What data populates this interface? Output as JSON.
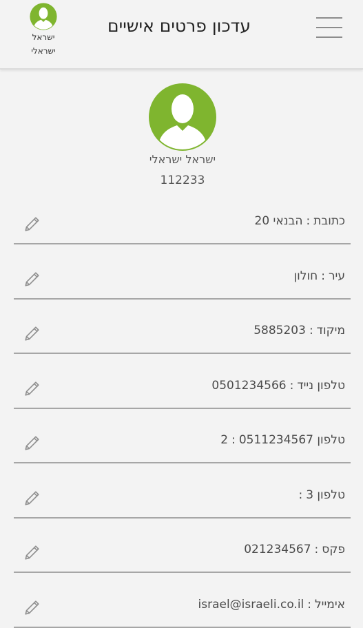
{
  "header": {
    "title": "עדכון פרטים אישיים",
    "user_first": "ישראל",
    "user_last": "ישראלי",
    "avatar_icon": "user-avatar-icon",
    "menu_icon": "hamburger-menu-icon"
  },
  "profile": {
    "name": "ישראל ישראלי",
    "id": "112233",
    "avatar_icon": "user-avatar-icon"
  },
  "colors": {
    "avatar_green": "#7fb52f",
    "line": "#a6a6a6",
    "background": "#f3f3f3"
  },
  "fields": [
    {
      "label": "כתובת",
      "value": "הבנאי 20"
    },
    {
      "label": "עיר",
      "value": "חולון"
    },
    {
      "label": "מיקוד",
      "value": "5885203"
    },
    {
      "label": "טלפון נייד",
      "value": "0501234566"
    },
    {
      "label": "טלפון 2",
      "value": "0511234567"
    },
    {
      "label": "טלפון 3",
      "value": ""
    },
    {
      "label": "פקס",
      "value": "021234567"
    },
    {
      "label": "אימייל",
      "value": "israel@israeli.co.il"
    }
  ],
  "edit_icon": "pencil-icon",
  "separator": ":"
}
